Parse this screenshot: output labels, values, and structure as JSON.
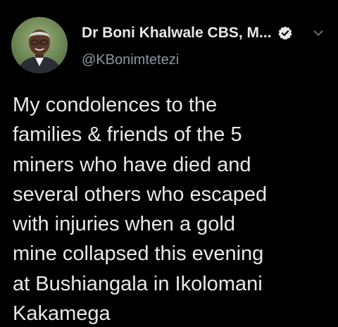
{
  "author": {
    "display_name": "Dr Boni Khalwale CBS, M...",
    "handle": "@KBonimtetezi",
    "verified_icon": "verified-badge-icon",
    "menu_icon": "chevron-down-icon"
  },
  "tweet": {
    "text": "My condolences to the\nfamilies & friends of the 5\nminers who have died and\nseveral others who escaped\nwith injuries when a gold\nmine collapsed this evening\nat Bushiangala in Ikolomani\nKakamega"
  },
  "colors": {
    "background": "#000000",
    "text_primary": "#e7e9ea",
    "text_secondary": "#8b98a5"
  }
}
